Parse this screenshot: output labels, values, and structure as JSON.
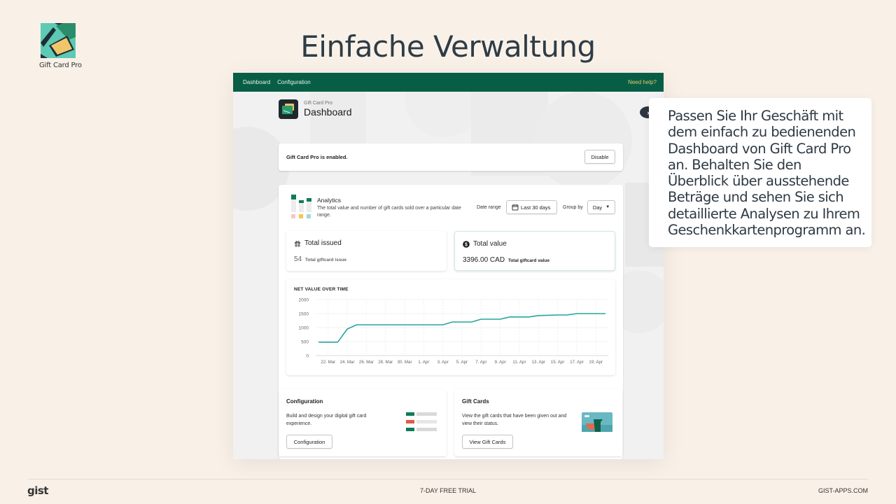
{
  "brand": {
    "name": "Gift Card Pro"
  },
  "hero": {
    "title": "Einfache Verwaltung"
  },
  "app": {
    "nav": [
      {
        "label": "Dashboard"
      },
      {
        "label": "Configuration"
      }
    ],
    "help_label": "Need help?",
    "page_subtitle": "Gift Card Pro",
    "page_title": "Dashboard",
    "status": {
      "text": "Gift Card Pro is enabled.",
      "button": "Disable"
    },
    "analytics": {
      "title": "Analytics",
      "description": "The total value and number of gift cards sold over a particular date range.",
      "date_range_label": "Date range",
      "date_range_value": "Last 30 days",
      "group_by_label": "Group by",
      "group_by_value": "Day"
    },
    "stats": [
      {
        "title": "Total issued",
        "icon": "gift-icon",
        "value": "54",
        "caption": "Total giftcard issue"
      },
      {
        "title": "Total value",
        "icon": "dollar-circle-icon",
        "value": "3396.00 CAD",
        "caption": "Total giftcard value"
      }
    ],
    "config_card": {
      "title": "Configuration",
      "description": "Build and design your digital gift card experience.",
      "button": "Configuration"
    },
    "giftcards_card": {
      "title": "Gift Cards",
      "description": "View the gift cards that have been given out and view their status.",
      "button": "View Gift Cards"
    }
  },
  "chart_data": {
    "type": "line",
    "title": "NET VALUE OVER TIME",
    "xlabel": "",
    "ylabel": "",
    "ylim": [
      0,
      2000
    ],
    "yticks": [
      0,
      500,
      1000,
      1500,
      2000
    ],
    "x_tick_labels": [
      "22. Mar",
      "24. Mar",
      "26. Mar",
      "28. Mar",
      "30. Mar",
      "1. Apr",
      "3. Apr",
      "5. Apr",
      "7. Apr",
      "9. Apr",
      "11. Apr",
      "13. Apr",
      "15. Apr",
      "17. Apr",
      "19. Apr"
    ],
    "grid": true,
    "color": "#26a69a",
    "x": [
      "21. Mar",
      "22. Mar",
      "23. Mar",
      "24. Mar",
      "25. Mar",
      "26. Mar",
      "27. Mar",
      "28. Mar",
      "29. Mar",
      "30. Mar",
      "31. Mar",
      "1. Apr",
      "2. Apr",
      "3. Apr",
      "4. Apr",
      "5. Apr",
      "6. Apr",
      "7. Apr",
      "8. Apr",
      "9. Apr",
      "10. Apr",
      "11. Apr",
      "12. Apr",
      "13. Apr",
      "14. Apr",
      "15. Apr",
      "16. Apr",
      "17. Apr",
      "18. Apr",
      "19. Apr",
      "20. Apr"
    ],
    "values": [
      480,
      480,
      480,
      950,
      1100,
      1100,
      1100,
      1100,
      1100,
      1100,
      1100,
      1100,
      1100,
      1100,
      1200,
      1200,
      1200,
      1300,
      1300,
      1300,
      1380,
      1380,
      1380,
      1430,
      1440,
      1450,
      1450,
      1500,
      1500,
      1500,
      1500
    ]
  },
  "tooltip": {
    "text": "Passen Sie Ihr Geschäft mit\ndem einfach zu bedienenden\nDashboard von Gift Card Pro\nan. Behalten Sie den\nÜberblick über ausstehende\nBeträge und sehen Sie sich\ndetaillierte Analysen zu Ihrem\nGeschenkkartenprogramm an."
  },
  "footer": {
    "logo": "gist",
    "center": "7-DAY FREE TRIAL",
    "right": "GIST-APPS.COM"
  }
}
